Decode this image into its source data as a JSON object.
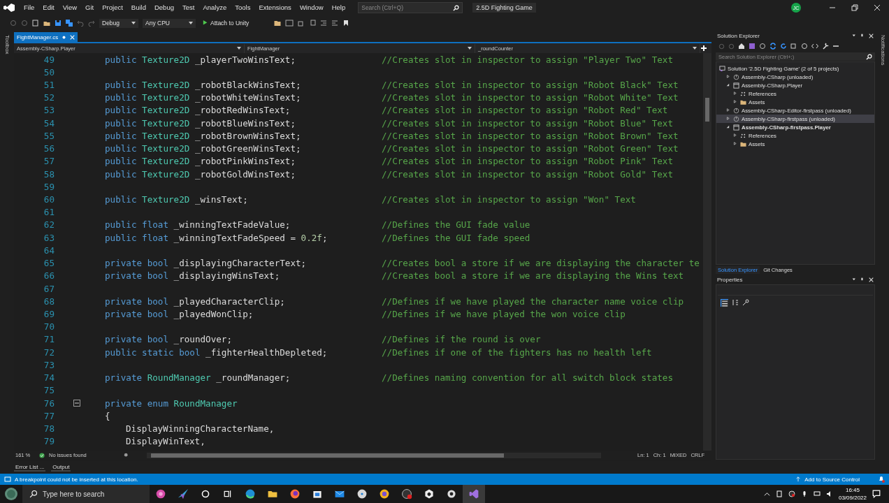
{
  "title_bar": {
    "menu": [
      "File",
      "Edit",
      "View",
      "Git",
      "Project",
      "Build",
      "Debug",
      "Test",
      "Analyze",
      "Tools",
      "Extensions",
      "Window",
      "Help"
    ],
    "search": {
      "placeholder": "Search (Ctrl+Q)"
    },
    "title": "2.5D Fighting Game",
    "avatar": "JC"
  },
  "toolbar": {
    "configuration": "Debug",
    "platform": "Any CPU",
    "run": "Attach to Unity"
  },
  "toolbox": {
    "label": "Toolbox"
  },
  "editor": {
    "tabs": [
      {
        "label": "FightManager.cs",
        "selected": true
      }
    ],
    "nav": [
      "Assembly-CSharp.Player",
      "FightManager",
      "_roundCounter"
    ],
    "lines": [
      {
        "number": "49",
        "collapsible": false,
        "code": [
          {
            "kind": "keyword",
            "text": "public "
          },
          {
            "kind": "type",
            "text": "Texture2D "
          },
          {
            "kind": "name",
            "text": "_playerTwoWinsText;"
          }
        ],
        "comment": "//Creates slot in inspector to assign \"Player Two\" Text"
      },
      {
        "number": "50",
        "collapsible": false
      },
      {
        "number": "51",
        "collapsible": false,
        "code": [
          {
            "kind": "keyword",
            "text": "public "
          },
          {
            "kind": "type",
            "text": "Texture2D "
          },
          {
            "kind": "name",
            "text": "_robotBlackWinsText;"
          }
        ],
        "comment": "//Creates slot in inspector to assign \"Robot Black\" Text"
      },
      {
        "number": "52",
        "collapsible": false,
        "code": [
          {
            "kind": "keyword",
            "text": "public "
          },
          {
            "kind": "type",
            "text": "Texture2D "
          },
          {
            "kind": "name",
            "text": "_robotWhiteWinsText;"
          }
        ],
        "comment": "//Creates slot in inspector to assign \"Robot White\" Text"
      },
      {
        "number": "53",
        "collapsible": false,
        "code": [
          {
            "kind": "keyword",
            "text": "public "
          },
          {
            "kind": "type",
            "text": "Texture2D "
          },
          {
            "kind": "name",
            "text": "_robotRedWinsText;"
          }
        ],
        "comment": "//Creates slot in inspector to assign \"Robot Red\" Text"
      },
      {
        "number": "54",
        "collapsible": false,
        "code": [
          {
            "kind": "keyword",
            "text": "public "
          },
          {
            "kind": "type",
            "text": "Texture2D "
          },
          {
            "kind": "name",
            "text": "_robotBlueWinsText;"
          }
        ],
        "comment": "//Creates slot in inspector to assign \"Robot Blue\" Text"
      },
      {
        "number": "55",
        "collapsible": false,
        "code": [
          {
            "kind": "keyword",
            "text": "public "
          },
          {
            "kind": "type",
            "text": "Texture2D "
          },
          {
            "kind": "name",
            "text": "_robotBrownWinsText;"
          }
        ],
        "comment": "//Creates slot in inspector to assign \"Robot Brown\" Text"
      },
      {
        "number": "56",
        "collapsible": false,
        "code": [
          {
            "kind": "keyword",
            "text": "public "
          },
          {
            "kind": "type",
            "text": "Texture2D "
          },
          {
            "kind": "name",
            "text": "_robotGreenWinsText;"
          }
        ],
        "comment": "//Creates slot in inspector to assign \"Robot Green\" Text"
      },
      {
        "number": "57",
        "collapsible": false,
        "code": [
          {
            "kind": "keyword",
            "text": "public "
          },
          {
            "kind": "type",
            "text": "Texture2D "
          },
          {
            "kind": "name",
            "text": "_robotPinkWinsText;"
          }
        ],
        "comment": "//Creates slot in inspector to assign \"Robot Pink\" Text"
      },
      {
        "number": "58",
        "collapsible": false,
        "code": [
          {
            "kind": "keyword",
            "text": "public "
          },
          {
            "kind": "type",
            "text": "Texture2D "
          },
          {
            "kind": "name",
            "text": "_robotGoldWinsText;"
          }
        ],
        "comment": "//Creates slot in inspector to assign \"Robot Gold\" Text"
      },
      {
        "number": "59",
        "collapsible": false
      },
      {
        "number": "60",
        "collapsible": false,
        "code": [
          {
            "kind": "keyword",
            "text": "public "
          },
          {
            "kind": "type",
            "text": "Texture2D "
          },
          {
            "kind": "name",
            "text": "_winsText;"
          }
        ],
        "comment": "//Creates slot in inspector to assign \"Won\" Text"
      },
      {
        "number": "61",
        "collapsible": false
      },
      {
        "number": "62",
        "collapsible": false,
        "code": [
          {
            "kind": "keyword",
            "text": "public float "
          },
          {
            "kind": "name",
            "text": "_winningTextFadeValue;"
          }
        ],
        "comment": "//Defines the GUI fade value"
      },
      {
        "number": "63",
        "collapsible": false,
        "code": [
          {
            "kind": "keyword",
            "text": "public float "
          },
          {
            "kind": "name",
            "text": "_winningTextFadeSpeed = "
          },
          {
            "kind": "number",
            "text": "0.2f"
          },
          {
            "kind": "name",
            "text": ";"
          }
        ],
        "comment": "//Defines the GUI fade speed"
      },
      {
        "number": "64",
        "collapsible": false
      },
      {
        "number": "65",
        "collapsible": false,
        "code": [
          {
            "kind": "keyword",
            "text": "private bool "
          },
          {
            "kind": "name",
            "text": "_displayingCharacterText;"
          }
        ],
        "comment": "//Creates bool a store if we are displaying the character te"
      },
      {
        "number": "66",
        "collapsible": false,
        "code": [
          {
            "kind": "keyword",
            "text": "private bool "
          },
          {
            "kind": "name",
            "text": "_displayingWinsText;"
          }
        ],
        "comment": "//Creates bool a store if we are displaying the Wins text"
      },
      {
        "number": "67",
        "collapsible": false
      },
      {
        "number": "68",
        "collapsible": false,
        "code": [
          {
            "kind": "keyword",
            "text": "private bool "
          },
          {
            "kind": "name",
            "text": "_playedCharacterClip;"
          }
        ],
        "comment": "//Defines if we have played the character name voice clip"
      },
      {
        "number": "69",
        "collapsible": false,
        "code": [
          {
            "kind": "keyword",
            "text": "private bool "
          },
          {
            "kind": "name",
            "text": "_playedWonClip;"
          }
        ],
        "comment": "//Defines if we have played the won voice clip"
      },
      {
        "number": "70",
        "collapsible": false
      },
      {
        "number": "71",
        "collapsible": false,
        "code": [
          {
            "kind": "keyword",
            "text": "private bool "
          },
          {
            "kind": "name",
            "text": "_roundOver;"
          }
        ],
        "comment": "//Defines if the round is over"
      },
      {
        "number": "72",
        "collapsible": false,
        "code": [
          {
            "kind": "keyword",
            "text": "public static bool "
          },
          {
            "kind": "name",
            "text": "_fighterHealthDepleted;"
          }
        ],
        "comment": "//Defines if one of the fighters has no health left"
      },
      {
        "number": "73",
        "collapsible": false
      },
      {
        "number": "74",
        "collapsible": false,
        "code": [
          {
            "kind": "keyword",
            "text": "private "
          },
          {
            "kind": "type",
            "text": "RoundManager "
          },
          {
            "kind": "name",
            "text": "_roundManager;"
          }
        ],
        "comment": "//Defines naming convention for all switch block states"
      },
      {
        "number": "75",
        "collapsible": false
      },
      {
        "number": "76",
        "collapsible": true,
        "code": [
          {
            "kind": "keyword",
            "text": "private enum "
          },
          {
            "kind": "type",
            "text": "RoundManager"
          }
        ]
      },
      {
        "number": "77",
        "collapsible": false,
        "code": [
          {
            "kind": "name",
            "text": "{"
          }
        ],
        "children": [
          {
            "number": "78",
            "collapsible": false,
            "code": [
              {
                "kind": "name",
                "text": "DisplayWinningCharacterName,"
              }
            ]
          },
          {
            "number": "79",
            "collapsible": false,
            "code": [
              {
                "kind": "name",
                "text": "DisplayWinText,"
              }
            ]
          }
        ]
      }
    ],
    "status": {
      "zoom": "161 %",
      "issues": "No issues found",
      "line": "Ln: 1",
      "column": "Ch: 1",
      "encoding": "MIXED",
      "line_endings": "CRLF"
    }
  },
  "solution_explorer": {
    "title": "Solution Explorer",
    "search": {
      "placeholder": "Search Solution Explorer (Ctrl+;)"
    },
    "tree": [
      {
        "label": "Solution '2.5D Fighting Game' (2 of 5 projects)",
        "kind": "solution",
        "selected": false,
        "startup": false,
        "children": [
          {
            "label": "Assembly-CSharp (unloaded)",
            "kind": "unloaded",
            "expanded": false,
            "selected": false,
            "startup": false
          },
          {
            "label": "Assembly-CSharp.Player",
            "kind": "project",
            "expanded": true,
            "selected": false,
            "startup": false,
            "children": [
              {
                "label": "References",
                "kind": "references",
                "expanded": false,
                "selected": false,
                "startup": false
              },
              {
                "label": "Assets",
                "kind": "folder",
                "expanded": false,
                "selected": false,
                "startup": false
              }
            ]
          },
          {
            "label": "Assembly-CSharp-Editor-firstpass (unloaded)",
            "kind": "unloaded",
            "expanded": false,
            "selected": false,
            "startup": false
          },
          {
            "label": "Assembly-CSharp-firstpass (unloaded)",
            "kind": "unloaded",
            "expanded": false,
            "selected": true,
            "startup": false
          },
          {
            "label": "Assembly-CSharp-firstpass.Player",
            "kind": "project",
            "expanded": true,
            "selected": false,
            "startup": true,
            "children": [
              {
                "label": "References",
                "kind": "references",
                "expanded": false,
                "selected": false,
                "startup": false
              },
              {
                "label": "Assets",
                "kind": "folder",
                "expanded": false,
                "selected": false,
                "startup": false
              }
            ]
          }
        ]
      }
    ],
    "tabs": [
      {
        "label": "Solution Explorer",
        "selected": true
      },
      {
        "label": "Git Changes",
        "selected": false
      }
    ]
  },
  "properties": {
    "title": "Properties"
  },
  "notifications": {
    "label": "Notifications"
  },
  "tool_tabs": [
    "Error List ...",
    "Output"
  ],
  "status_bar": {
    "message": "A breakpoint could not be inserted at this location.",
    "source_control": "Add to Source Control"
  },
  "taskbar": {
    "search": {
      "placeholder": "Type here to search"
    },
    "time": "16:45",
    "date": "03/09/2022"
  }
}
